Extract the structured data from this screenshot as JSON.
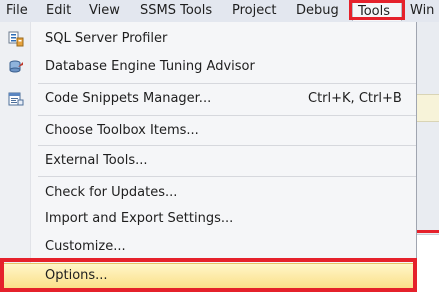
{
  "menubar": {
    "items": [
      "File",
      "Edit",
      "View",
      "SSMS Tools",
      "Project",
      "Debug",
      "Tools",
      "Win"
    ]
  },
  "tools_menu": {
    "items": [
      {
        "label": "SQL Server Profiler",
        "icon": "profiler-icon"
      },
      {
        "label": "Database Engine Tuning Advisor",
        "icon": "tuning-advisor-icon"
      },
      {
        "label": "Code Snippets Manager...",
        "shortcut": "Ctrl+K, Ctrl+B",
        "icon": "snippets-icon"
      },
      {
        "label": "Choose Toolbox Items..."
      },
      {
        "label": "External Tools..."
      },
      {
        "label": "Check for Updates..."
      },
      {
        "label": "Import and Export Settings..."
      },
      {
        "label": "Customize..."
      },
      {
        "label": "Options...",
        "highlighted": true
      }
    ]
  },
  "colors": {
    "highlight_border": "#e5212b",
    "hover_fill": "#fbe08a",
    "menubar_bg": "#e3e7ef",
    "menu_bg": "#f5f6f8"
  }
}
